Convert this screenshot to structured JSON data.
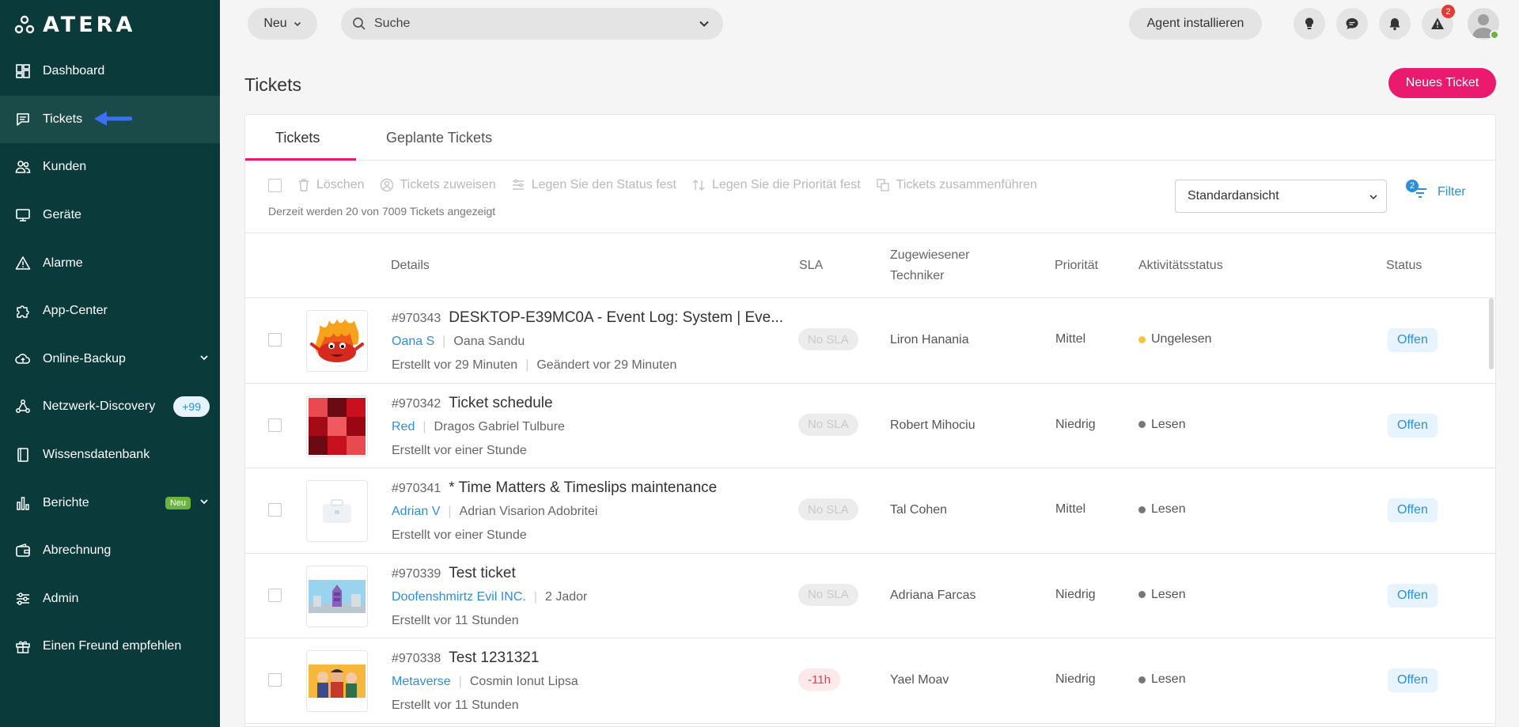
{
  "brand": {
    "name": "ATERA"
  },
  "sidebar": {
    "items": [
      {
        "label": "Dashboard",
        "icon": "dashboard-icon"
      },
      {
        "label": "Tickets",
        "icon": "ticket-icon"
      },
      {
        "label": "Kunden",
        "icon": "customers-icon"
      },
      {
        "label": "Geräte",
        "icon": "devices-icon"
      },
      {
        "label": "Alarme",
        "icon": "alert-icon"
      },
      {
        "label": "App-Center",
        "icon": "puzzle-icon"
      },
      {
        "label": "Online-Backup",
        "icon": "cloud-icon"
      },
      {
        "label": "Netzwerk-Discovery",
        "icon": "network-icon",
        "badge": "+99"
      },
      {
        "label": "Wissensdatenbank",
        "icon": "book-icon"
      },
      {
        "label": "Berichte",
        "icon": "chart-icon",
        "tag": "Neu"
      },
      {
        "label": "Abrechnung",
        "icon": "wallet-icon"
      },
      {
        "label": "Admin",
        "icon": "sliders-icon"
      },
      {
        "label": "Einen Freund empfehlen",
        "icon": "gift-icon"
      }
    ]
  },
  "topbar": {
    "new_label": "Neu",
    "search_placeholder": "Suche",
    "agent_label": "Agent installieren",
    "alert_count": "2"
  },
  "page": {
    "title": "Tickets",
    "new_ticket_label": "Neues Ticket"
  },
  "tabs": [
    "Tickets",
    "Geplante Tickets"
  ],
  "toolbar": {
    "delete": "Löschen",
    "assign": "Tickets zuweisen",
    "set_status": "Legen Sie den Status fest",
    "set_priority": "Legen Sie die Priorität fest",
    "merge": "Tickets zusammenführen",
    "count_text": "Derzeit werden 20 von 7009 Tickets angezeigt",
    "view": "Standardansicht",
    "filter_label": "Filter",
    "filter_count": "2"
  },
  "columns": {
    "details": "Details",
    "sla": "SLA",
    "tech_line1": "Zugewiesener",
    "tech_line2": "Techniker",
    "priority": "Priorität",
    "activity": "Aktivitätsstatus",
    "status": "Status"
  },
  "tickets": [
    {
      "id": "#970343",
      "title": "DESKTOP-E39MC0A - Event Log: System | Eve...",
      "customer": "Oana S",
      "contact": "Oana Sandu",
      "created": "Erstellt vor 29 Minuten",
      "modified": "Geändert vor 29 Minuten",
      "sla": "No SLA",
      "tech": "Liron Hanania",
      "priority": "Mittel",
      "activity": "Ungelesen",
      "activity_color": "#f5c43a",
      "status": "Offen"
    },
    {
      "id": "#970342",
      "title": "Ticket schedule",
      "customer": "Red",
      "contact": "Dragos Gabriel Tulbure",
      "created": "Erstellt vor einer Stunde",
      "modified": "",
      "sla": "No SLA",
      "tech": "Robert Mihociu",
      "priority": "Niedrig",
      "activity": "Lesen",
      "activity_color": "#777777",
      "status": "Offen"
    },
    {
      "id": "#970341",
      "title": "* Time Matters & Timeslips maintenance",
      "customer": "Adrian V",
      "contact": "Adrian Visarion Adobritei",
      "created": "Erstellt vor einer Stunde",
      "modified": "",
      "sla": "No SLA",
      "tech": "Tal Cohen",
      "priority": "Mittel",
      "activity": "Lesen",
      "activity_color": "#777777",
      "status": "Offen"
    },
    {
      "id": "#970339",
      "title": "Test ticket",
      "customer": "Doofenshmirtz Evil INC.",
      "contact": "2 Jador",
      "created": "Erstellt vor 11 Stunden",
      "modified": "",
      "sla": "No SLA",
      "tech": "Adriana Farcas",
      "priority": "Niedrig",
      "activity": "Lesen",
      "activity_color": "#777777",
      "status": "Offen"
    },
    {
      "id": "#970338",
      "title": "Test 1231321",
      "customer": "Metaverse",
      "contact": "Cosmin Ionut Lipsa",
      "created": "Erstellt vor 11 Stunden",
      "modified": "",
      "sla": "-11h",
      "tech": "Yael Moav",
      "priority": "Niedrig",
      "activity": "Lesen",
      "activity_color": "#777777",
      "status": "Offen"
    }
  ]
}
